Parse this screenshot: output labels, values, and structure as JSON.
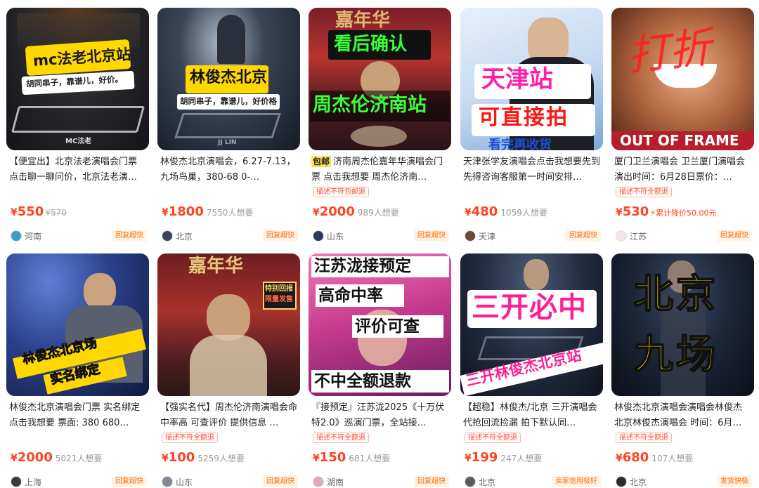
{
  "cards": [
    {
      "img_text": [
        "mc法老北京站",
        "胡同串子，靠谱儿，好价。",
        "MC法老"
      ],
      "title": "【便宜出】北京法老演唱会门票 点击聊一聊问价，北京法老演…",
      "postage": "",
      "warn": "",
      "price_symbol": "¥",
      "price": "550",
      "orig_price": "¥570",
      "wants": "",
      "drop": "",
      "location": "河南",
      "badge": "回复超快"
    },
    {
      "img_text": [
        "林俊杰北京",
        "胡同串子，靠谱儿，好价格",
        "JJ LIN"
      ],
      "title": "林俊杰北京演唱会，6.27-7.13，九场鸟巢，380-68 0-…",
      "postage": "",
      "warn": "",
      "price_symbol": "¥",
      "price": "1800",
      "orig_price": "",
      "wants": "7550人想要",
      "drop": "",
      "location": "北京",
      "badge": "回复超快"
    },
    {
      "img_text": [
        "看后确认",
        "周杰伦济南站",
        "嘉年华"
      ],
      "title": "济南周杰伦嘉年华演唱会门票 点击我想要 周杰伦济南…",
      "postage": "包邮",
      "warn": "描述不符包邮退",
      "price_symbol": "¥",
      "price": "2000",
      "orig_price": "",
      "wants": "989人想要",
      "drop": "",
      "location": "山东",
      "badge": "回复超快"
    },
    {
      "img_text": [
        "天津站",
        "可直接拍",
        "看完再收货"
      ],
      "title": "天津张学友演唱会点击我想要先到先得咨询客服第一时间安排…",
      "postage": "",
      "warn": "",
      "price_symbol": "¥",
      "price": "480",
      "orig_price": "",
      "wants": "1059人想要",
      "drop": "",
      "location": "天津",
      "badge": "回复超快"
    },
    {
      "img_text": [
        "打折",
        "OUT OF FRAME"
      ],
      "title": "厦门卫兰演唱会 卫兰厦门演唱会演出时间：6月28日票价：…",
      "postage": "",
      "warn": "描述不符全额退",
      "price_symbol": "¥",
      "price": "530",
      "orig_price": "",
      "wants": "",
      "drop": "累计降价50.00元",
      "location": "江苏",
      "badge": "回复超快"
    },
    {
      "img_text": [
        "林俊杰北京场",
        "实名绑定"
      ],
      "title": "林俊杰北京演唱会门票 实名绑定 点击我想要 票面: 380 680…",
      "postage": "",
      "warn": "",
      "price_symbol": "¥",
      "price": "2000",
      "orig_price": "",
      "wants": "5021人想要",
      "drop": "",
      "location": "上海",
      "badge": "回复超快"
    },
    {
      "img_text": [
        "嘉年华",
        "特别回报",
        "限量发售"
      ],
      "title": "【强实名代】周杰伦济南演唱会命中率高 可查评价 提供信息 …",
      "postage": "",
      "warn": "描述不符全额退",
      "price_symbol": "¥",
      "price": "100",
      "orig_price": "",
      "wants": "5259人想要",
      "drop": "",
      "location": "山东",
      "badge": "回复超快"
    },
    {
      "img_text": [
        "汪苏泷接预定",
        "高命中率",
        "评价可查",
        "不中全额退款"
      ],
      "title": "『接预定』汪苏泷2025《十万伏特2.0》巡演门票，全站接…",
      "postage": "",
      "warn": "描述不符全额退",
      "price_symbol": "¥",
      "price": "150",
      "orig_price": "",
      "wants": "681人想要",
      "drop": "",
      "location": "湖南",
      "badge": "回复超快"
    },
    {
      "img_text": [
        "三开必中",
        "三开林俊杰北京站"
      ],
      "title": "【超稳】林俊杰/北京 三开演唱会代抢回流捡漏 拍下默认同…",
      "postage": "",
      "warn": "描述不符全额退",
      "price_symbol": "¥",
      "price": "199",
      "orig_price": "",
      "wants": "247人想要",
      "drop": "",
      "location": "北京",
      "badge": "卖家信用极好"
    },
    {
      "img_text": [
        "北京",
        "九场"
      ],
      "title": "林俊杰北京演唱会演唱会林俊杰 北京林俊杰演唱会 时间：6月…",
      "postage": "",
      "warn": "描述不符全额退",
      "price_symbol": "¥",
      "price": "680",
      "orig_price": "",
      "wants": "107人想要",
      "drop": "",
      "location": "北京",
      "badge": "发货快极"
    }
  ]
}
